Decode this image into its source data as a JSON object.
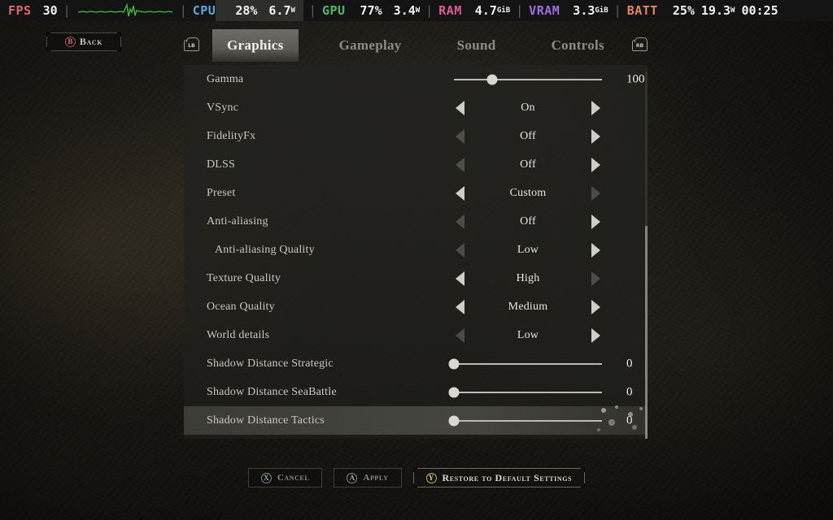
{
  "hud": {
    "fps": {
      "label": "FPS",
      "value": "30",
      "graph_icon": "fps-line-graph",
      "color": "#d96a6a"
    },
    "cpu": {
      "label": "CPU",
      "usage": "28%",
      "power": "6.7",
      "power_unit": "W",
      "color": "#5aa8d6"
    },
    "gpu": {
      "label": "GPU",
      "usage": "77%",
      "power": "3.4",
      "power_unit": "W",
      "color": "#4fb86a"
    },
    "ram": {
      "label": "RAM",
      "value": "4.7",
      "unit": "GiB",
      "color": "#e05a9a"
    },
    "vram": {
      "label": "VRAM",
      "value": "3.3",
      "unit": "GiB",
      "color": "#a06ee0"
    },
    "batt": {
      "label": "BATT",
      "percent": "25%",
      "power": "19.3",
      "power_unit": "W",
      "time": "00:25",
      "color": "#e08a5a"
    },
    "separator": "|"
  },
  "back_button": {
    "glyph": "B",
    "label": "Back",
    "glyph_color": "#d2707a"
  },
  "tabs": {
    "left_shoulder": "LB",
    "right_shoulder": "RB",
    "items": [
      {
        "label": "Graphics",
        "active": true
      },
      {
        "label": "Gameplay",
        "active": false
      },
      {
        "label": "Sound",
        "active": false
      },
      {
        "label": "Controls",
        "active": false
      }
    ]
  },
  "settings": [
    {
      "name": "Gamma",
      "type": "slider",
      "value": "100",
      "percent": 26,
      "indent": false,
      "selected": false
    },
    {
      "name": "VSync",
      "type": "stepper",
      "value": "On",
      "left_enabled": true,
      "right_enabled": true,
      "indent": false,
      "selected": false
    },
    {
      "name": "FidelityFx",
      "type": "stepper",
      "value": "Off",
      "left_enabled": false,
      "right_enabled": true,
      "indent": false,
      "selected": false
    },
    {
      "name": "DLSS",
      "type": "stepper",
      "value": "Off",
      "left_enabled": false,
      "right_enabled": true,
      "indent": false,
      "selected": false
    },
    {
      "name": "Preset",
      "type": "stepper",
      "value": "Custom",
      "left_enabled": true,
      "right_enabled": false,
      "indent": false,
      "selected": false
    },
    {
      "name": "Anti-aliasing",
      "type": "stepper",
      "value": "Off",
      "left_enabled": false,
      "right_enabled": true,
      "indent": false,
      "selected": false
    },
    {
      "name": "Anti-aliasing Quality",
      "type": "stepper",
      "value": "Low",
      "left_enabled": false,
      "right_enabled": true,
      "indent": true,
      "selected": false
    },
    {
      "name": "Texture Quality",
      "type": "stepper",
      "value": "High",
      "left_enabled": true,
      "right_enabled": false,
      "indent": false,
      "selected": false
    },
    {
      "name": "Ocean Quality",
      "type": "stepper",
      "value": "Medium",
      "left_enabled": true,
      "right_enabled": true,
      "indent": false,
      "selected": false
    },
    {
      "name": "World details",
      "type": "stepper",
      "value": "Low",
      "left_enabled": false,
      "right_enabled": true,
      "indent": false,
      "selected": false
    },
    {
      "name": "Shadow Distance Strategic",
      "type": "slider",
      "value": "0",
      "percent": 0,
      "indent": false,
      "selected": false
    },
    {
      "name": "Shadow Distance SeaBattle",
      "type": "slider",
      "value": "0",
      "percent": 0,
      "indent": false,
      "selected": false
    },
    {
      "name": "Shadow Distance Tactics",
      "type": "slider",
      "value": "0",
      "percent": 0,
      "indent": false,
      "selected": true
    }
  ],
  "scrollbar": {
    "thumb_top_pct": 42,
    "thumb_height_pct": 58
  },
  "actions": [
    {
      "glyph": "X",
      "label": "Cancel",
      "primary": false,
      "glyph_class": "pad-x"
    },
    {
      "glyph": "A",
      "label": "Apply",
      "primary": false,
      "glyph_class": "pad-a"
    },
    {
      "glyph": "Y",
      "label": "Restore to Default Settings",
      "primary": true,
      "glyph_class": "pad-y"
    }
  ]
}
